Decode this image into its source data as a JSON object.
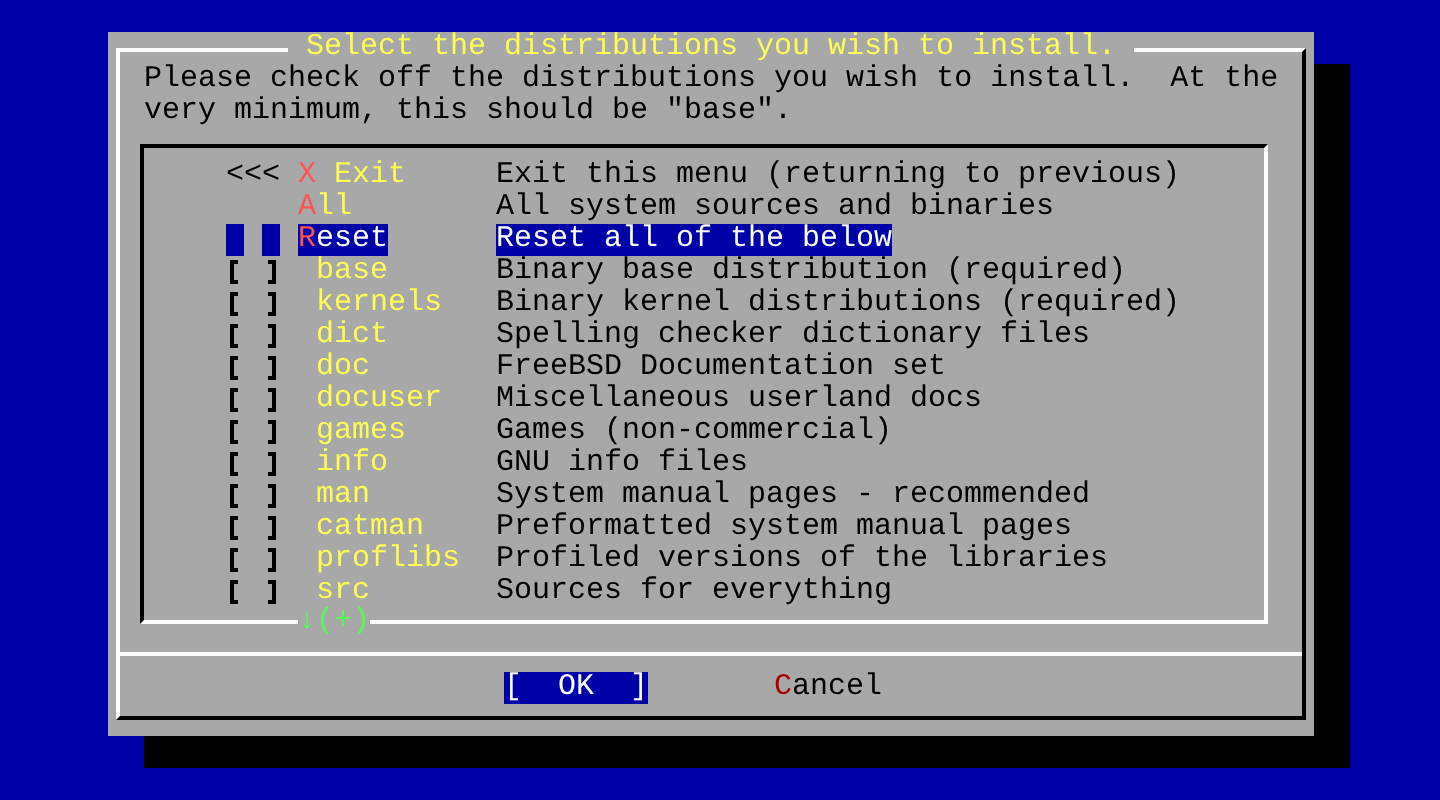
{
  "dialog": {
    "title": "Select the distributions you wish to install.",
    "instructions": "Please check off the distributions you wish to install.  At the very minimum, this should be \"base\".",
    "items": [
      {
        "kind": "exit",
        "prefix": "<<<",
        "label": "X Exit",
        "description": "Exit this menu (returning to previous)",
        "selected": false
      },
      {
        "kind": "action",
        "label": "All",
        "description": "All system sources and binaries",
        "selected": false
      },
      {
        "kind": "action",
        "label": "Reset",
        "description": "Reset all of the below",
        "selected": true
      },
      {
        "kind": "dist",
        "label": "base",
        "description": "Binary base distribution (required)",
        "checked": false,
        "selected": false
      },
      {
        "kind": "dist",
        "label": "kernels",
        "description": "Binary kernel distributions (required)",
        "checked": false,
        "selected": false
      },
      {
        "kind": "dist",
        "label": "dict",
        "description": "Spelling checker dictionary files",
        "checked": false,
        "selected": false
      },
      {
        "kind": "dist",
        "label": "doc",
        "description": "FreeBSD Documentation set",
        "checked": false,
        "selected": false
      },
      {
        "kind": "dist",
        "label": "docuser",
        "description": "Miscellaneous userland docs",
        "checked": false,
        "selected": false
      },
      {
        "kind": "dist",
        "label": "games",
        "description": "Games (non-commercial)",
        "checked": false,
        "selected": false
      },
      {
        "kind": "dist",
        "label": "info",
        "description": "GNU info files",
        "checked": false,
        "selected": false
      },
      {
        "kind": "dist",
        "label": "man",
        "description": "System manual pages - recommended",
        "checked": false,
        "selected": false
      },
      {
        "kind": "dist",
        "label": "catman",
        "description": "Preformatted system manual pages",
        "checked": false,
        "selected": false
      },
      {
        "kind": "dist",
        "label": "proflibs",
        "description": "Profiled versions of the libraries",
        "checked": false,
        "selected": false
      },
      {
        "kind": "dist",
        "label": "src",
        "description": "Sources for everything",
        "checked": false,
        "selected": false
      }
    ],
    "more_indicator": "↓(+)",
    "buttons": [
      {
        "label": "[  OK  ]",
        "selected": true
      },
      {
        "label": "Cancel",
        "selected": false
      }
    ]
  }
}
